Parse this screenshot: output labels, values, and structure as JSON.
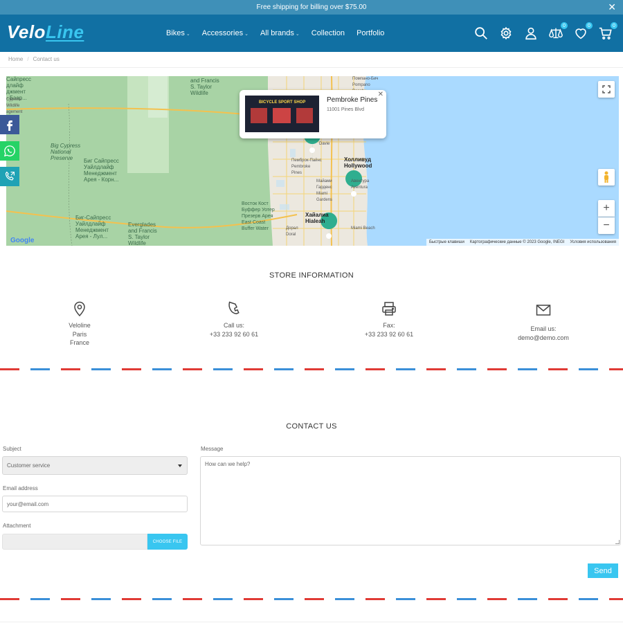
{
  "promo": {
    "text": "Free shipping for billing over $75.00"
  },
  "logo": {
    "part1": "Velo",
    "part2": "Line"
  },
  "nav": [
    {
      "label": "Bikes",
      "has_dropdown": true
    },
    {
      "label": "Accessories",
      "has_dropdown": true
    },
    {
      "label": "All brands",
      "has_dropdown": true
    },
    {
      "label": "Collection",
      "has_dropdown": false
    },
    {
      "label": "Portfolio",
      "has_dropdown": false
    }
  ],
  "header_icons": {
    "compare_count": "0",
    "wishlist_count": "0",
    "cart_count": "0"
  },
  "breadcrumb": [
    "Home",
    "Contact us"
  ],
  "map": {
    "infowindow_name": "Pembroke Pines",
    "infowindow_address": "11001 Pines Blvd",
    "photo_sign": "BICYCLE SPORT SHOP",
    "footer": [
      "Быстрые клавиши",
      "Картографические данные © 2023 Google, INEGI",
      "Условия использования"
    ],
    "labels": {
      "hollywood": "Холливуд\nHollywood",
      "hialeah": "Хайалиа\nHialeah",
      "pembroke": "Пемброк-Пайнс\nPembroke\nPines",
      "miami_gardens": "Майами\nГарденс\nMiami\nGardens",
      "aventura": "Авентура\nAventura",
      "miami_beach": "Miami Beach",
      "big_cypress": "Big Cypress\nNational\nPreserve",
      "big_cypress_ru": "Биг Сайпресс\nУайлдлайф\nМенеджмент\nАрея - Корн...",
      "big_cypress_ru2": "Биг-Сайпресс\nУайлдлайф\nМенеджмент\nАрея - Лул...",
      "everglades": "Everglades\nand Francis\nS. Taylor\nWildlife",
      "everglades_top": "and Francis\nS. Taylor\nWildlife",
      "pompano": "Помпано-Бич\nPompano\nBeach",
      "davie": "Davie",
      "doral": "Дорал\nDoral",
      "east_coast": "Восток Кост\nБуффер Уотер\nПрезерв Арея\nEast Coast\nBuffer Water",
      "left_top": "Сайпресс\nдлайф\nджмент\n- Бэар...",
      "left_mid": "Cypress\nWildlife\nagement"
    },
    "google_logo": "Google"
  },
  "social": [
    "facebook",
    "whatsapp",
    "phone"
  ],
  "store_info": {
    "title": "STORE INFORMATION",
    "address_lines": [
      "Veloline",
      "Paris",
      "France"
    ],
    "call_label": "Call us:",
    "call_value": "+33 233 92 60 61",
    "fax_label": "Fax:",
    "fax_value": "+33 233 92 60 61",
    "email_label": "Email us:",
    "email_value": "demo@demo.com"
  },
  "contact": {
    "title": "CONTACT US",
    "subject_label": "Subject",
    "subject_value": "Customer service",
    "email_label": "Email address",
    "email_placeholder": "your@email.com",
    "attachment_label": "Attachment",
    "choose_file": "CHOOSE FILE",
    "message_label": "Message",
    "message_placeholder": "How can we help?",
    "send": "Send"
  },
  "colors": {
    "header": "#1170a3",
    "promo": "#3f90b8",
    "accent": "#39c6f0",
    "facebook": "#3b5998",
    "whatsapp": "#25d366",
    "phone": "#1fa2b5"
  }
}
